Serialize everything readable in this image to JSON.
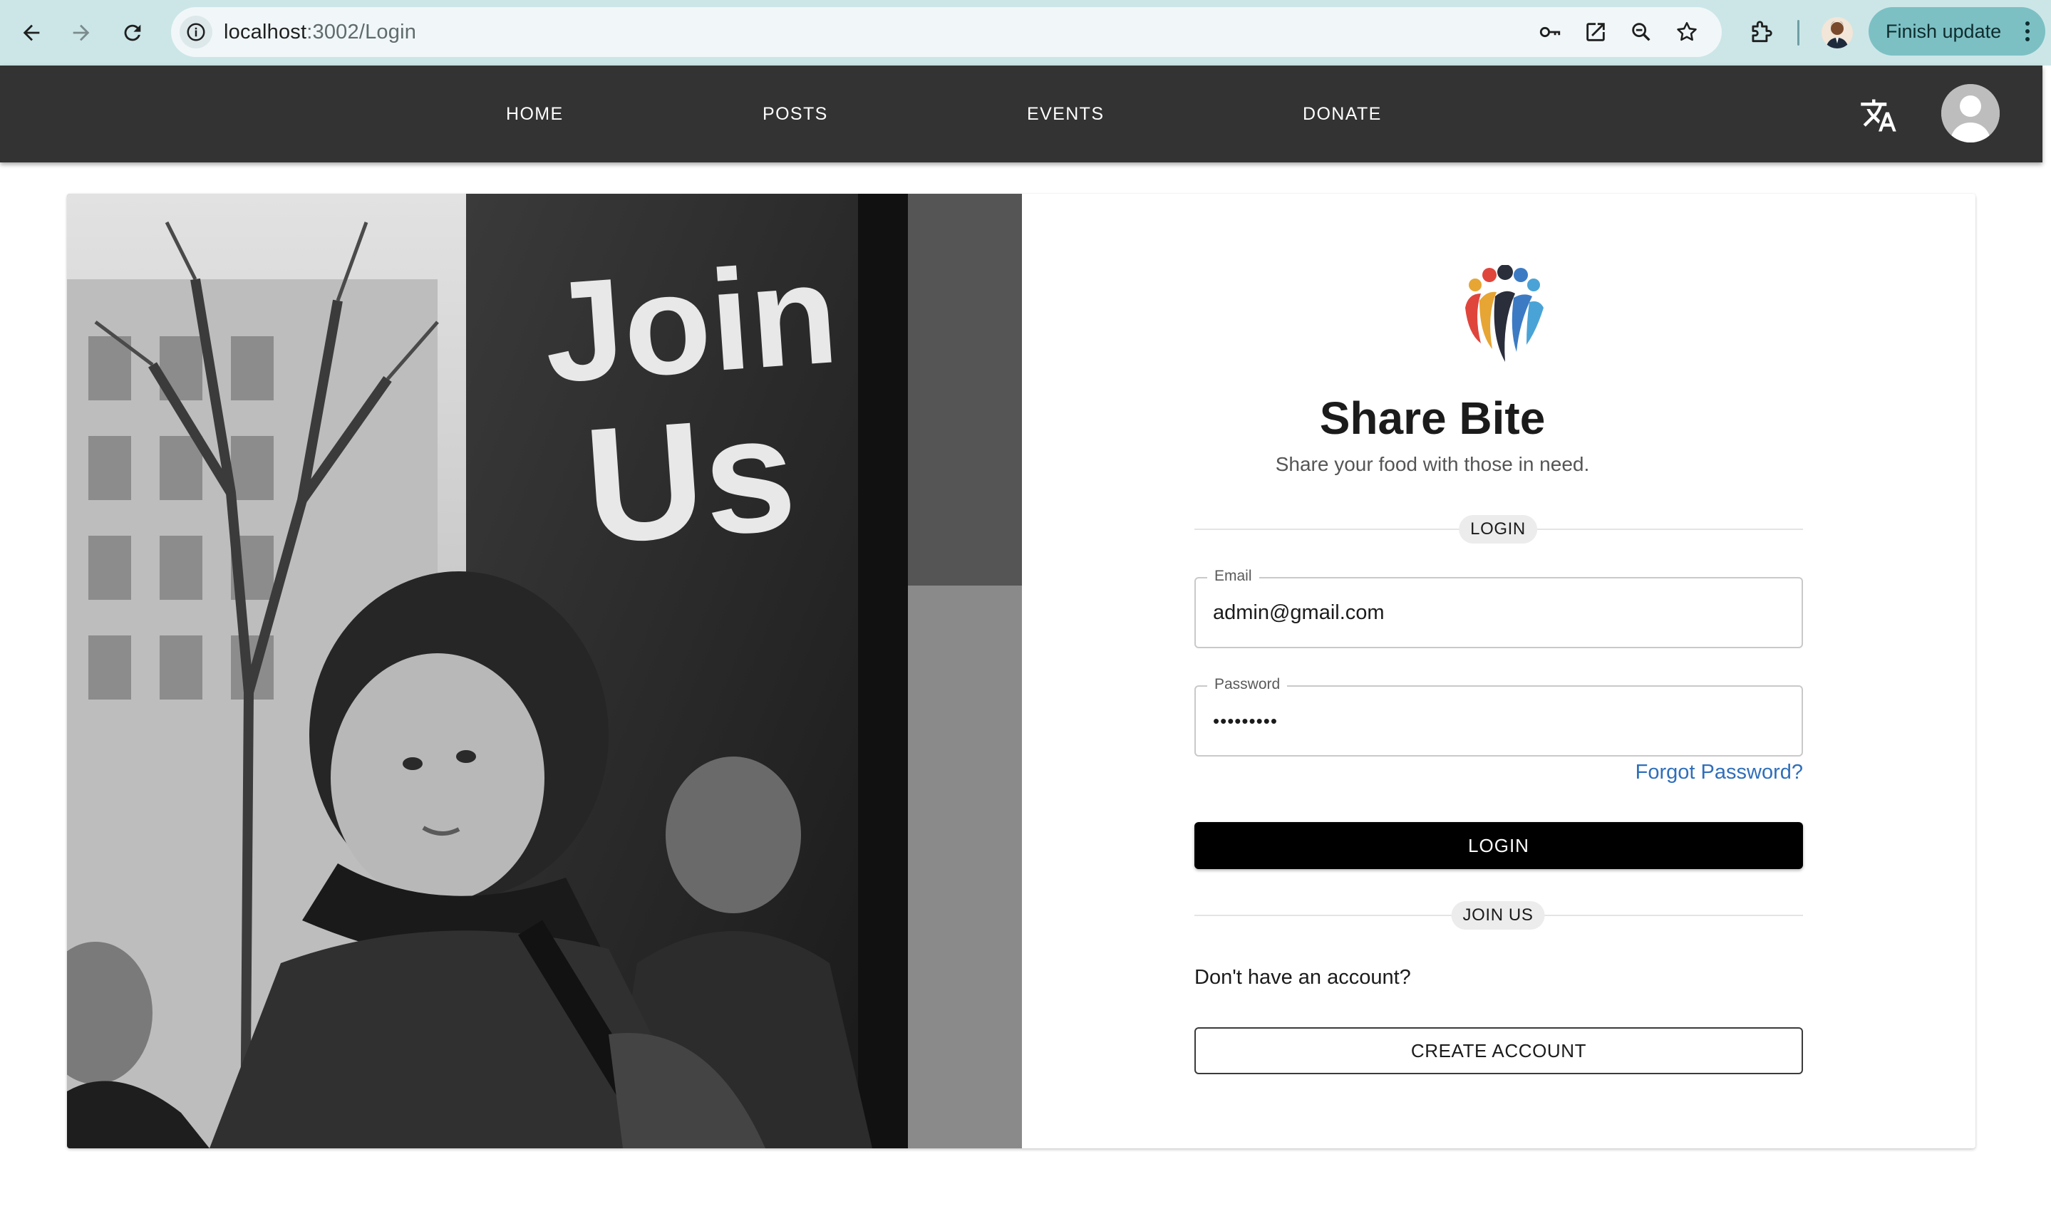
{
  "browser": {
    "url_host": "localhost",
    "url_path": ":3002/Login",
    "finish_update_label": "Finish update",
    "icons": [
      "back-arrow-icon",
      "forward-arrow-icon",
      "reload-icon",
      "site-info-icon",
      "password-key-icon",
      "open-in-new-icon",
      "zoom-icon",
      "star-bookmark-icon",
      "extensions-puzzle-icon",
      "profile-icon",
      "kebab-menu-icon"
    ]
  },
  "appbar": {
    "links": [
      "HOME",
      "POSTS",
      "EVENTS",
      "DONATE"
    ],
    "icons": [
      "translate-icon",
      "user-avatar-icon"
    ],
    "background_color": "#333333"
  },
  "hero": {
    "sign_line1": "Join",
    "sign_line2": "Us"
  },
  "brand": {
    "title": "Share Bite",
    "subtitle": "Share your food with those in need."
  },
  "login_form": {
    "section_chip": "LOGIN",
    "email_label": "Email",
    "email_value": "admin@gmail.com",
    "password_label": "Password",
    "password_value": "•••••••••",
    "forgot_link": "Forgot Password?",
    "submit_label": "LOGIN"
  },
  "signup": {
    "section_chip": "JOIN US",
    "prompt": "Don't have an account?",
    "button_label": "CREATE ACCOUNT"
  },
  "colors": {
    "chrome_bg": "#cce6e8",
    "finish_update_bg": "#7cc0c4",
    "link_blue": "#2f6fba",
    "primary_button": "#000000"
  }
}
